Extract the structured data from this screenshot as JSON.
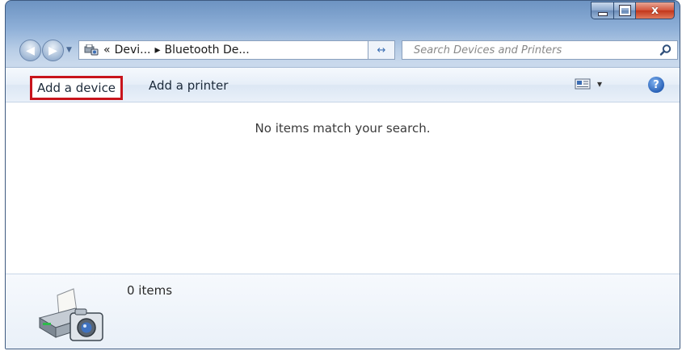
{
  "window": {
    "caption": {
      "minimize": "–",
      "maximize": "□",
      "close": "x"
    }
  },
  "nav": {
    "breadcrumb_prefix": "«",
    "breadcrumb_1": "Devi...",
    "breadcrumb_sep": "▸",
    "breadcrumb_2": "Bluetooth De...",
    "dropdown_glyph": "▾",
    "refresh_glyph": "↔"
  },
  "search": {
    "placeholder": "Search Devices and Printers",
    "value": ""
  },
  "toolbar": {
    "add_device": "Add a device",
    "add_printer": "Add a printer",
    "view_dropdown": "▾",
    "help": "?"
  },
  "content": {
    "empty_message": "No items match your search."
  },
  "details": {
    "count": "0 items"
  },
  "colors": {
    "highlight_border": "#c8141c",
    "toolbar_bg": "#e6eef8",
    "title_accent": "#6d93c2"
  },
  "icons": [
    "back-arrow-icon",
    "forward-arrow-icon",
    "devices-and-printers-icon",
    "refresh-icon",
    "search-icon",
    "change-view-icon",
    "help-icon",
    "printer-camera-icon"
  ]
}
